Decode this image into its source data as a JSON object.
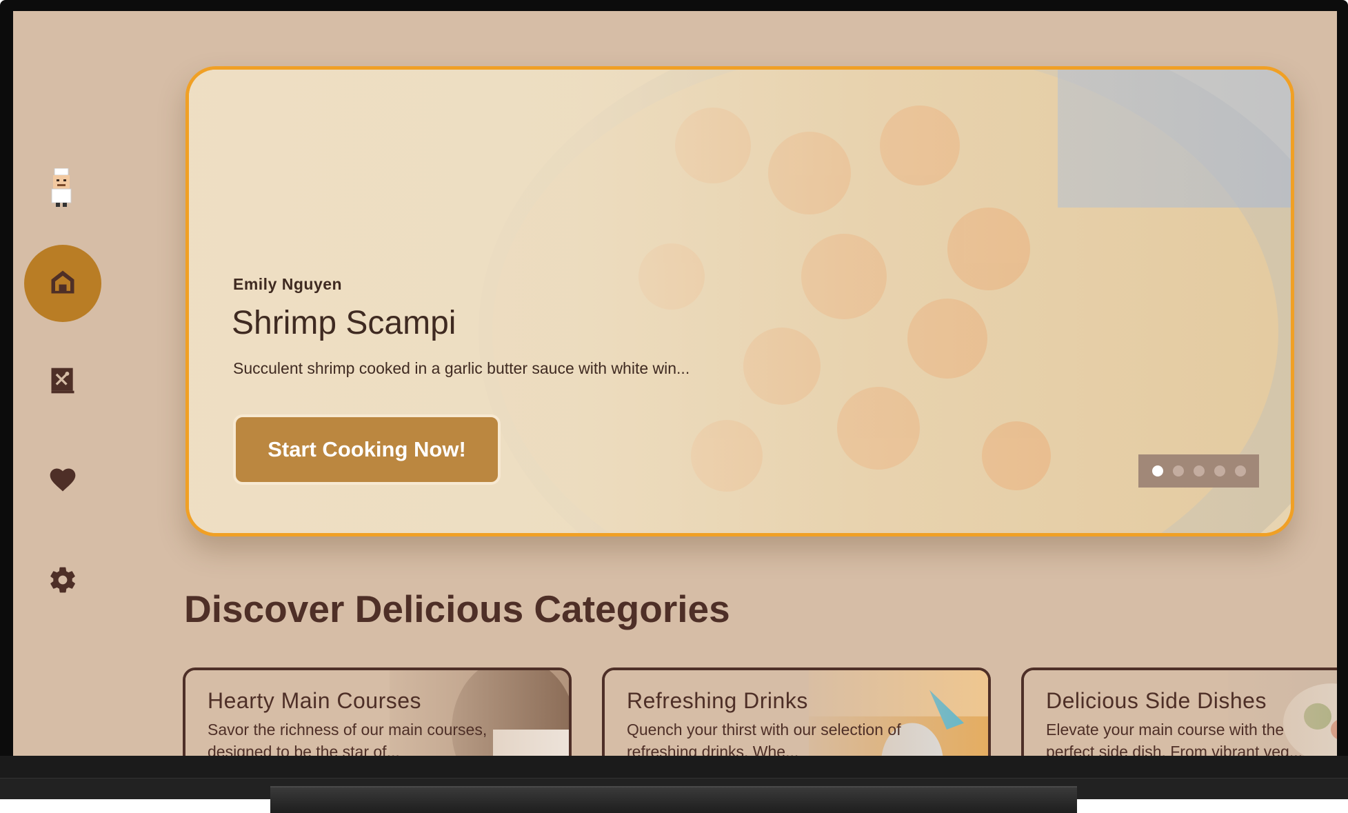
{
  "nav": {
    "items": [
      {
        "name": "home",
        "icon": "home-icon",
        "active": true
      },
      {
        "name": "recipe-book",
        "icon": "recipe-book-icon",
        "active": false
      },
      {
        "name": "favorites",
        "icon": "heart-icon",
        "active": false
      },
      {
        "name": "settings",
        "icon": "gear-icon",
        "active": false
      }
    ],
    "logo_icon": "chef-avatar-icon"
  },
  "hero": {
    "author": "Emily Nguyen",
    "title": "Shrimp Scampi",
    "description": "Succulent shrimp cooked in a garlic butter sauce with white win...",
    "cta_label": "Start Cooking Now!",
    "carousel": {
      "count": 5,
      "active_index": 0
    }
  },
  "section": {
    "title": "Discover Delicious Categories"
  },
  "categories": [
    {
      "title": "Hearty Main Courses",
      "description": "Savor the richness of our main courses, designed to be the star of..."
    },
    {
      "title": "Refreshing Drinks",
      "description": "Quench your thirst with our selection of refreshing drinks. Whe..."
    },
    {
      "title": "Delicious Side Dishes",
      "description": "Elevate your main course with the perfect side dish. From vibrant veg..."
    }
  ],
  "colors": {
    "background": "#d6bda6",
    "accent": "#b97d25",
    "hero_border": "#f0a025",
    "text_dark": "#4e2f27",
    "button": "#bb8740"
  }
}
